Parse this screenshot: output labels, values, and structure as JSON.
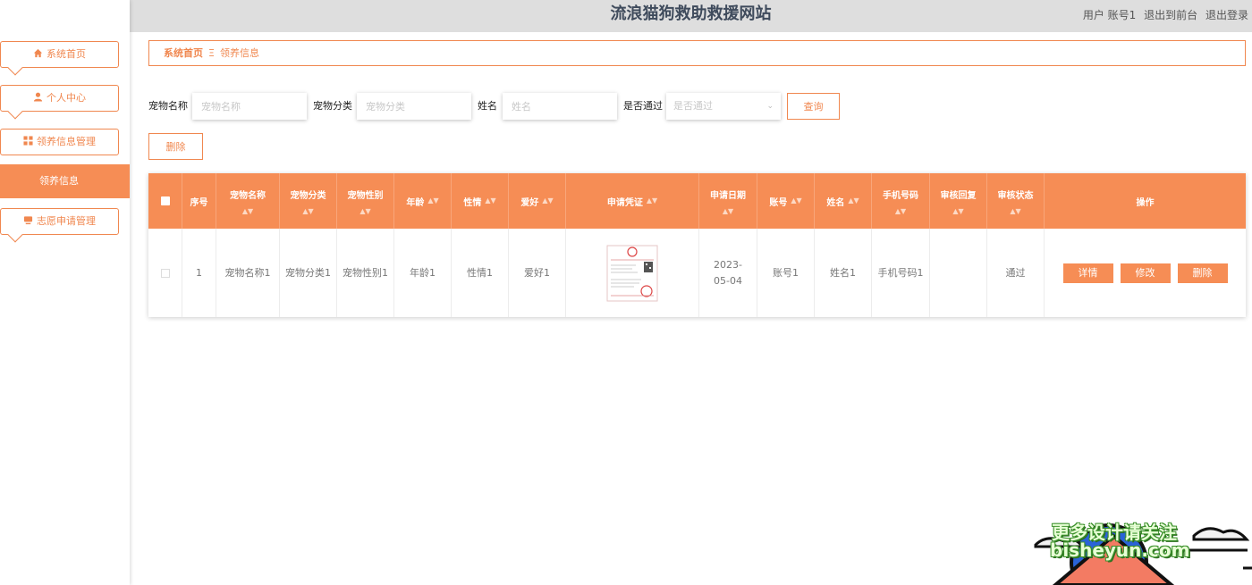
{
  "colors": {
    "accent": "#f68d55",
    "border": "#f0874f",
    "topbar": "#dedede",
    "title": "#3f4b5c"
  },
  "header": {
    "title": "流浪猫狗救助救援网站",
    "user_label": "用户 账号1",
    "to_front": "退出到前台",
    "logout": "退出登录"
  },
  "sidebar": {
    "items": [
      {
        "label": "系统首页",
        "icon": "home-icon"
      },
      {
        "label": "个人中心",
        "icon": "user-icon"
      },
      {
        "label": "领养信息管理",
        "icon": "grid-icon"
      },
      {
        "label": "志愿申请管理",
        "icon": "monitor-icon"
      }
    ],
    "active_sub": "领养信息"
  },
  "breadcrumb": {
    "home": "系统首页",
    "separator": "Ξ",
    "current": "领养信息"
  },
  "search": {
    "pet_name_label": "宠物名称",
    "pet_name_placeholder": "宠物名称",
    "pet_type_label": "宠物分类",
    "pet_type_placeholder": "宠物分类",
    "name_label": "姓名",
    "name_placeholder": "姓名",
    "passed_label": "是否通过",
    "passed_placeholder": "是否通过",
    "query_button": "查询"
  },
  "toolbar": {
    "delete_button": "删除"
  },
  "table": {
    "headers": {
      "index": "序号",
      "pet_name": "宠物名称",
      "pet_type": "宠物分类",
      "pet_gender": "宠物性别",
      "age": "年龄",
      "temperament": "性情",
      "hobby": "爱好",
      "certificate": "申请凭证",
      "apply_date": "申请日期",
      "account": "账号",
      "name": "姓名",
      "phone": "手机号码",
      "review_reply": "审核回复",
      "review_status": "审核状态",
      "actions": "操作"
    },
    "rows": [
      {
        "index": "1",
        "pet_name": "宠物名称1",
        "pet_type": "宠物分类1",
        "pet_gender": "宠物性别1",
        "age": "年龄1",
        "temperament": "性情1",
        "hobby": "爱好1",
        "apply_date": "2023-05-04",
        "account": "账号1",
        "name": "姓名1",
        "phone": "手机号码1",
        "review_reply": "",
        "review_status": "通过",
        "detail_button": "详情",
        "edit_button": "修改",
        "delete_button": "删除"
      }
    ]
  },
  "watermark": {
    "line1": "更多设计请关注",
    "line2": "bisheyun.com"
  }
}
